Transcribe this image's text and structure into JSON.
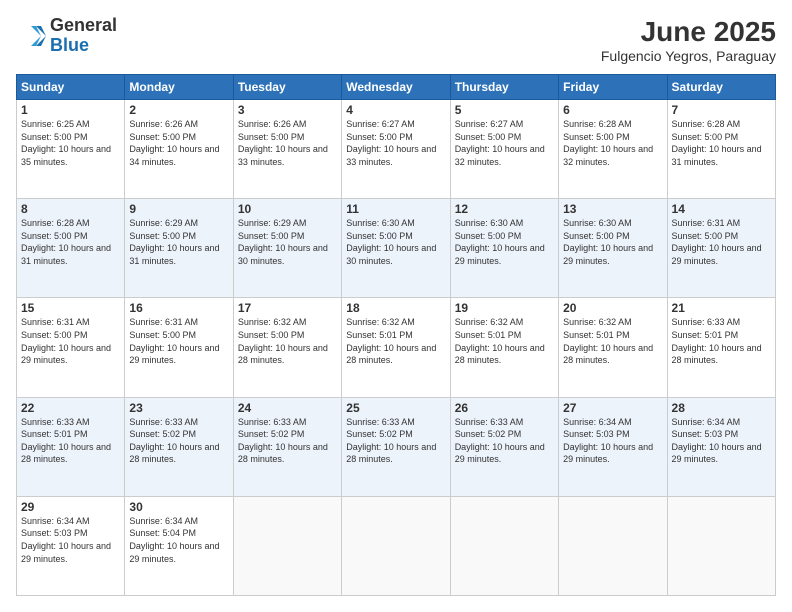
{
  "logo": {
    "general": "General",
    "blue": "Blue"
  },
  "title": "June 2025",
  "subtitle": "Fulgencio Yegros, Paraguay",
  "days_of_week": [
    "Sunday",
    "Monday",
    "Tuesday",
    "Wednesday",
    "Thursday",
    "Friday",
    "Saturday"
  ],
  "weeks": [
    [
      {
        "day": "1",
        "sunrise": "6:25 AM",
        "sunset": "5:00 PM",
        "daylight": "10 hours and 35 minutes."
      },
      {
        "day": "2",
        "sunrise": "6:26 AM",
        "sunset": "5:00 PM",
        "daylight": "10 hours and 34 minutes."
      },
      {
        "day": "3",
        "sunrise": "6:26 AM",
        "sunset": "5:00 PM",
        "daylight": "10 hours and 33 minutes."
      },
      {
        "day": "4",
        "sunrise": "6:27 AM",
        "sunset": "5:00 PM",
        "daylight": "10 hours and 33 minutes."
      },
      {
        "day": "5",
        "sunrise": "6:27 AM",
        "sunset": "5:00 PM",
        "daylight": "10 hours and 32 minutes."
      },
      {
        "day": "6",
        "sunrise": "6:28 AM",
        "sunset": "5:00 PM",
        "daylight": "10 hours and 32 minutes."
      },
      {
        "day": "7",
        "sunrise": "6:28 AM",
        "sunset": "5:00 PM",
        "daylight": "10 hours and 31 minutes."
      }
    ],
    [
      {
        "day": "8",
        "sunrise": "6:28 AM",
        "sunset": "5:00 PM",
        "daylight": "10 hours and 31 minutes."
      },
      {
        "day": "9",
        "sunrise": "6:29 AM",
        "sunset": "5:00 PM",
        "daylight": "10 hours and 31 minutes."
      },
      {
        "day": "10",
        "sunrise": "6:29 AM",
        "sunset": "5:00 PM",
        "daylight": "10 hours and 30 minutes."
      },
      {
        "day": "11",
        "sunrise": "6:30 AM",
        "sunset": "5:00 PM",
        "daylight": "10 hours and 30 minutes."
      },
      {
        "day": "12",
        "sunrise": "6:30 AM",
        "sunset": "5:00 PM",
        "daylight": "10 hours and 29 minutes."
      },
      {
        "day": "13",
        "sunrise": "6:30 AM",
        "sunset": "5:00 PM",
        "daylight": "10 hours and 29 minutes."
      },
      {
        "day": "14",
        "sunrise": "6:31 AM",
        "sunset": "5:00 PM",
        "daylight": "10 hours and 29 minutes."
      }
    ],
    [
      {
        "day": "15",
        "sunrise": "6:31 AM",
        "sunset": "5:00 PM",
        "daylight": "10 hours and 29 minutes."
      },
      {
        "day": "16",
        "sunrise": "6:31 AM",
        "sunset": "5:00 PM",
        "daylight": "10 hours and 29 minutes."
      },
      {
        "day": "17",
        "sunrise": "6:32 AM",
        "sunset": "5:00 PM",
        "daylight": "10 hours and 28 minutes."
      },
      {
        "day": "18",
        "sunrise": "6:32 AM",
        "sunset": "5:01 PM",
        "daylight": "10 hours and 28 minutes."
      },
      {
        "day": "19",
        "sunrise": "6:32 AM",
        "sunset": "5:01 PM",
        "daylight": "10 hours and 28 minutes."
      },
      {
        "day": "20",
        "sunrise": "6:32 AM",
        "sunset": "5:01 PM",
        "daylight": "10 hours and 28 minutes."
      },
      {
        "day": "21",
        "sunrise": "6:33 AM",
        "sunset": "5:01 PM",
        "daylight": "10 hours and 28 minutes."
      }
    ],
    [
      {
        "day": "22",
        "sunrise": "6:33 AM",
        "sunset": "5:01 PM",
        "daylight": "10 hours and 28 minutes."
      },
      {
        "day": "23",
        "sunrise": "6:33 AM",
        "sunset": "5:02 PM",
        "daylight": "10 hours and 28 minutes."
      },
      {
        "day": "24",
        "sunrise": "6:33 AM",
        "sunset": "5:02 PM",
        "daylight": "10 hours and 28 minutes."
      },
      {
        "day": "25",
        "sunrise": "6:33 AM",
        "sunset": "5:02 PM",
        "daylight": "10 hours and 28 minutes."
      },
      {
        "day": "26",
        "sunrise": "6:33 AM",
        "sunset": "5:02 PM",
        "daylight": "10 hours and 29 minutes."
      },
      {
        "day": "27",
        "sunrise": "6:34 AM",
        "sunset": "5:03 PM",
        "daylight": "10 hours and 29 minutes."
      },
      {
        "day": "28",
        "sunrise": "6:34 AM",
        "sunset": "5:03 PM",
        "daylight": "10 hours and 29 minutes."
      }
    ],
    [
      {
        "day": "29",
        "sunrise": "6:34 AM",
        "sunset": "5:03 PM",
        "daylight": "10 hours and 29 minutes."
      },
      {
        "day": "30",
        "sunrise": "6:34 AM",
        "sunset": "5:04 PM",
        "daylight": "10 hours and 29 minutes."
      },
      null,
      null,
      null,
      null,
      null
    ]
  ]
}
